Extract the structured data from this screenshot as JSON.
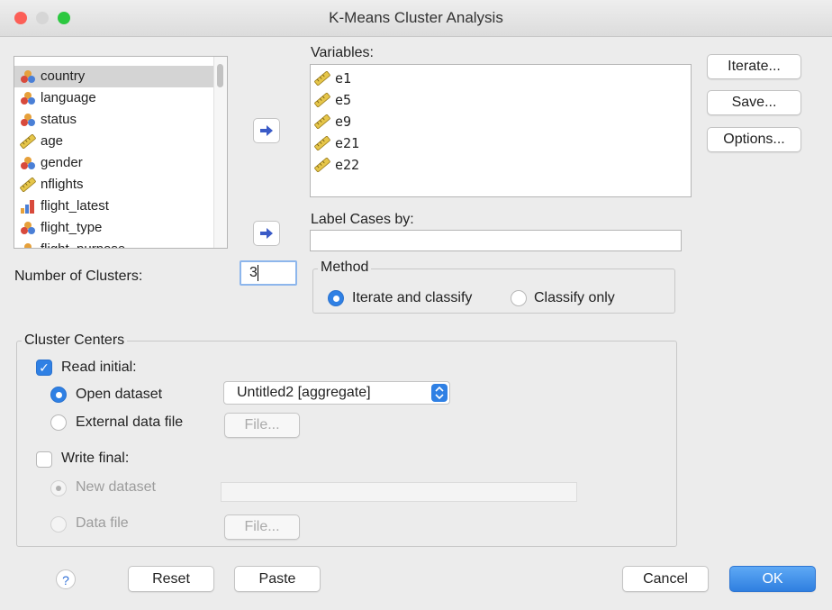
{
  "window": {
    "title": "K-Means Cluster Analysis"
  },
  "colors": {
    "accent": "#2f80e4",
    "close": "#fc5f57",
    "minimize": "#d6d6d6",
    "zoom": "#2cc840"
  },
  "source_list": {
    "items": [
      {
        "label": "country",
        "icon": "nominal-icon",
        "selected": true
      },
      {
        "label": "language",
        "icon": "nominal-icon"
      },
      {
        "label": "status",
        "icon": "nominal-icon"
      },
      {
        "label": "age",
        "icon": "scale-ruler-icon"
      },
      {
        "label": "gender",
        "icon": "nominal-icon"
      },
      {
        "label": "nflights",
        "icon": "scale-ruler-icon"
      },
      {
        "label": "flight_latest",
        "icon": "ordinal-bar-icon"
      },
      {
        "label": "flight_type",
        "icon": "nominal-icon"
      },
      {
        "label": "flight_purpose",
        "icon": "nominal-icon"
      }
    ]
  },
  "variables": {
    "label": "Variables:",
    "items": [
      "e1",
      "e5",
      "e9",
      "e21",
      "e22"
    ]
  },
  "label_cases": {
    "label": "Label Cases by:",
    "value": ""
  },
  "side_buttons": {
    "iterate": "Iterate...",
    "save": "Save...",
    "options": "Options..."
  },
  "clusters": {
    "label": "Number of Clusters:",
    "value": "3"
  },
  "method": {
    "legend": "Method",
    "options": [
      "Iterate and classify",
      "Classify only"
    ],
    "selected": "Iterate and classify"
  },
  "cluster_centers": {
    "legend": "Cluster Centers",
    "read_initial": {
      "label": "Read initial:",
      "checked": true
    },
    "open_dataset": {
      "label": "Open dataset",
      "selected_value": "Untitled2 [aggregate]"
    },
    "external_file": {
      "label": "External data file",
      "button": "File..."
    },
    "write_final": {
      "label": "Write final:",
      "checked": false
    },
    "new_dataset": {
      "label": "New dataset",
      "value": ""
    },
    "data_file": {
      "label": "Data file",
      "button": "File..."
    }
  },
  "footer": {
    "help": "?",
    "reset": "Reset",
    "paste": "Paste",
    "cancel": "Cancel",
    "ok": "OK"
  }
}
